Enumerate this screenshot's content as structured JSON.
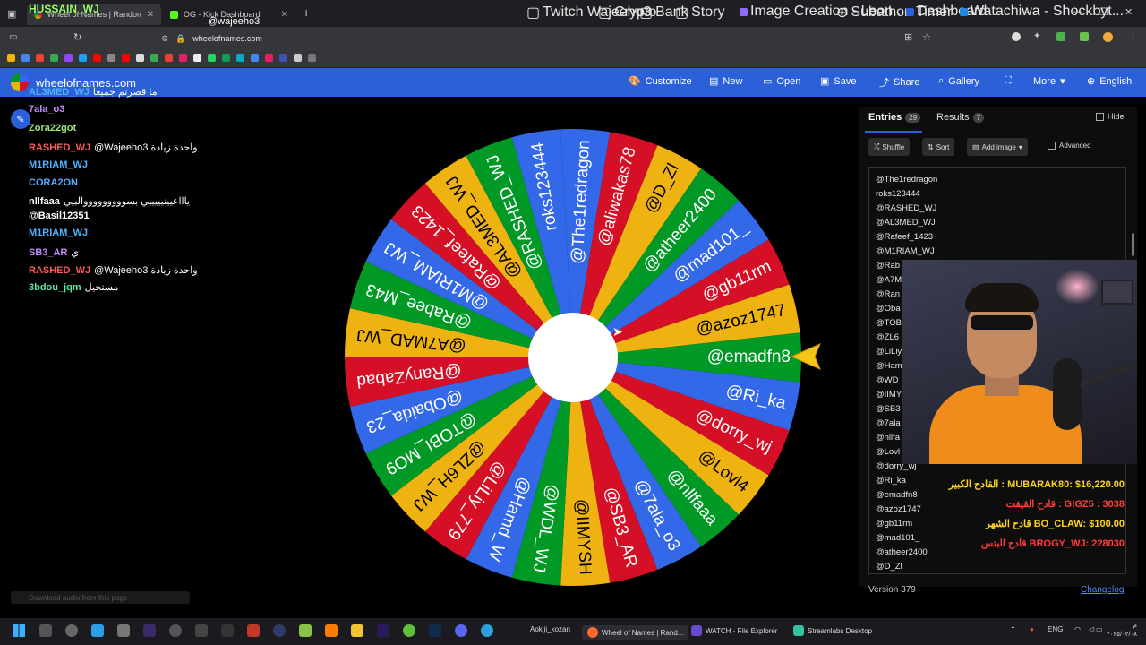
{
  "browser": {
    "tabs": [
      {
        "title": "Wheel of Names | Random nam",
        "active": true
      },
      {
        "title": "OG - Kick Dashboard",
        "active": false
      }
    ],
    "url": "wheelofnames.com",
    "bookmarks": [
      "Twitch Wajeeho3",
      "Crypto",
      "Bank",
      "Story",
      "Image Creation - Leon...",
      "Subathon Timer",
      "Dashboard",
      "Watachiwa - Shockbyt..."
    ]
  },
  "app": {
    "title": "wheelofnames.com",
    "nav": [
      "Customize",
      "New",
      "Open",
      "Save",
      "Share",
      "Gallery",
      "More",
      "English"
    ]
  },
  "overlay_name": "HUSSAIN_WJ",
  "overlay_handle": "@wajeeho3",
  "chat": [
    {
      "user": "AL3MED_WJ",
      "color": "#4fb2ff",
      "msg": "ما قصرتم جميعا"
    },
    {
      "user": "7ala_o3",
      "color": "#c38cff",
      "msg": ""
    },
    {
      "user": "Zora22got",
      "color": "#9be37b",
      "msg": ""
    },
    {
      "user": "RASHED_WJ",
      "color": "#ff5a5a",
      "msg": "@Wajeeho3 واحدة زيادة"
    },
    {
      "user": "M1RIAM_WJ",
      "color": "#4fb2ff",
      "msg": ""
    },
    {
      "user": "CORA2ON",
      "color": "#5aa9ff",
      "msg": ""
    },
    {
      "user": "nllfaaa",
      "color": "#ffffff",
      "msg": "ياااعيينيييييي بسوووووووووالبيي"
    },
    {
      "user": "@Basil12351",
      "color": "#ffffff",
      "msg": ""
    },
    {
      "user": "M1RIAM_WJ",
      "color": "#4fb2ff",
      "msg": ""
    },
    {
      "user": "SB3_AR",
      "color": "#c38cff",
      "msg": "ي"
    },
    {
      "user": "RASHED_WJ",
      "color": "#ff5a5a",
      "msg": "@Wajeeho3 واحدة زيادة"
    },
    {
      "user": "3bdou_jqm",
      "color": "#5fe0a5",
      "msg": "مستحيل"
    }
  ],
  "wheel": {
    "names": [
      "@The1redragon",
      "@aliwakas78",
      "@D_Zl",
      "@atheer2400",
      "@mad101_",
      "@gb11rm",
      "@azoz1747",
      "@emadfn8",
      "@Ri_ka",
      "@dorry_wj",
      "@Lovl4",
      "@nllfaaa",
      "@7ala_o3",
      "@SB3_AR",
      "@IIMYSH",
      "@WDL_WJ",
      "@Hamd_W",
      "@LiLiy_779",
      "@ZL6H_WJ",
      "@TOBI_MO9",
      "@Obaida_23",
      "@RanyZabad",
      "@A7MAD_WJ",
      "@Rabee_M43",
      "@M1RIAM_WJ",
      "@Rafeef_1423",
      "@AL3MED_WJ",
      "@RASHED_WJ",
      "roks123444"
    ],
    "colors": [
      "#3369e8",
      "#d50f25",
      "#eeb211",
      "#009925"
    ]
  },
  "panel": {
    "entries_label": "Entries",
    "entries_count": "29",
    "results_label": "Results",
    "results_count": "7",
    "hide_label": "Hide",
    "shuffle_label": "Shuffle",
    "sort_label": "Sort",
    "add_image_label": "Add image",
    "advanced_label": "Advanced",
    "entries": [
      "@The1redragon",
      "roks123444",
      "@RASHED_WJ",
      "@AL3MED_WJ",
      "@Rafeef_1423",
      "@M1RIAM_WJ",
      "@Rab",
      "@A7M",
      "@Ran",
      "@Oba",
      "@TOB",
      "@ZL6",
      "@LiLiy",
      "@Ham",
      "@WD",
      "@IIMY",
      "@SB3",
      "@7ala",
      "@nllfa",
      "@Lovl",
      "@dorry_wj",
      "@Ri_ka",
      "@emadfn8",
      "@azoz1747",
      "@gb11rm",
      "@mad101_",
      "@atheer2400",
      "@D_Zl"
    ],
    "version": "Version 379",
    "changelog": "Changelog"
  },
  "download_hint": "Download audio from this page",
  "donors": [
    {
      "text": "القادح الكبير : MUBARAK80: $16,220.00",
      "color": "#ffd21f"
    },
    {
      "text": "قادح القيفت : GIGZ5 : 3038",
      "color": "#ff3b3b"
    },
    {
      "text": "قادح الشهر BO_CLAW: $100.00",
      "color": "#ffd21f"
    },
    {
      "text": "قادح البتس BROGY_WJ: 228030",
      "color": "#ff3b3b"
    }
  ],
  "taskbar": {
    "apps": [
      "Aokiji_kozan",
      "Wheel of Names | Rand...",
      "WATCH - File Explorer",
      "Streamlabs Desktop"
    ],
    "lang": "ENG",
    "time": "م",
    "date": "٢٠٢٥/٠٢/٠٨"
  }
}
